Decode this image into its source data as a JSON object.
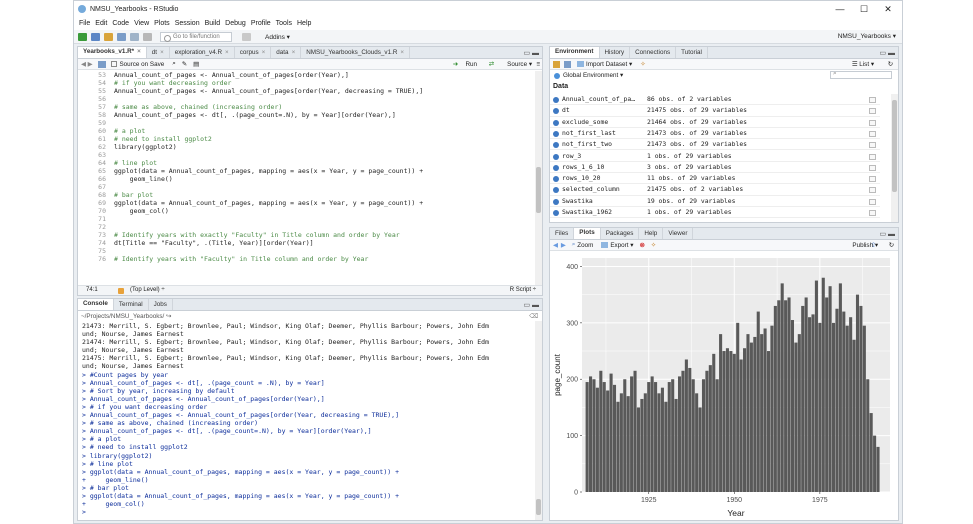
{
  "window": {
    "title": "NMSU_Yearbooks - RStudio",
    "minimize": "—",
    "maximize": "☐",
    "close": "✕"
  },
  "menu": [
    "File",
    "Edit",
    "Code",
    "View",
    "Plots",
    "Session",
    "Build",
    "Debug",
    "Profile",
    "Tools",
    "Help"
  ],
  "toolbar": {
    "goto_placeholder": "Go to file/function",
    "addins": "Addins ▾",
    "project": "NMSU_Yearbooks ▾"
  },
  "editor": {
    "tabs": [
      {
        "label": "Yearbooks_v1.R*",
        "active": true
      },
      {
        "label": "dt",
        "active": false
      },
      {
        "label": "exploration_v4.R",
        "active": false
      },
      {
        "label": "corpus",
        "active": false
      },
      {
        "label": "data",
        "active": false
      },
      {
        "label": "NMSU_Yearbooks_Clouds_v1.R",
        "active": false
      }
    ],
    "source_on_save": "Source on Save",
    "run": "Run",
    "source": "Source ▾",
    "lines": [
      {
        "n": "53",
        "t": "Annual_count_of_pages <- Annual_count_of_pages[order(Year),]"
      },
      {
        "n": "54",
        "t": "# if you want decreasing order"
      },
      {
        "n": "55",
        "t": "Annual_count_of_pages <- Annual_count_of_pages[order(Year, decreasing = TRUE),]"
      },
      {
        "n": "56",
        "t": ""
      },
      {
        "n": "57",
        "t": "# same as above, chained (increasing order)"
      },
      {
        "n": "58",
        "t": "Annual_count_of_pages <- dt[, .(page_count=.N), by = Year][order(Year),]"
      },
      {
        "n": "59",
        "t": ""
      },
      {
        "n": "60",
        "t": "# a plot"
      },
      {
        "n": "61",
        "t": "# need to install ggplot2"
      },
      {
        "n": "62",
        "t": "library(ggplot2)"
      },
      {
        "n": "63",
        "t": ""
      },
      {
        "n": "64",
        "t": "# line plot"
      },
      {
        "n": "65",
        "t": "ggplot(data = Annual_count_of_pages, mapping = aes(x = Year, y = page_count)) +"
      },
      {
        "n": "66",
        "t": "    geom_line()"
      },
      {
        "n": "67",
        "t": ""
      },
      {
        "n": "68",
        "t": "# bar plot"
      },
      {
        "n": "69",
        "t": "ggplot(data = Annual_count_of_pages, mapping = aes(x = Year, y = page_count)) +"
      },
      {
        "n": "70",
        "t": "    geom_col()"
      },
      {
        "n": "71",
        "t": ""
      },
      {
        "n": "72",
        "t": ""
      },
      {
        "n": "73",
        "t": "# Identify years with exactly \"Faculty\" in Title column and order by Year"
      },
      {
        "n": "74",
        "t": "dt[Title == \"Faculty\", .(Title, Year)][order(Year)]"
      },
      {
        "n": "75",
        "t": ""
      },
      {
        "n": "76",
        "t": "# Identify years with \"Faculty\" in Title column and order by Year"
      }
    ],
    "status_pos": "74:1",
    "status_scope": "(Top Level) ÷",
    "status_type": "R Script ÷"
  },
  "console": {
    "tabs": [
      {
        "label": "Console",
        "active": true
      },
      {
        "label": "Terminal",
        "active": false
      },
      {
        "label": "Jobs",
        "active": false
      }
    ],
    "path": "~/Projects/NMSU_Yearbooks/ ↪",
    "lines": [
      {
        "k": "o",
        "t": "21473: Merrill, S. Egbert; Brownlee, Paul; Windsor, King Olaf; Deemer, Phyllis Barbour; Powers, John Edm"
      },
      {
        "k": "o",
        "t": "und; Nourse, James Earnest"
      },
      {
        "k": "o",
        "t": "21474: Merrill, S. Egbert; Brownlee, Paul; Windsor, King Olaf; Deemer, Phyllis Barbour; Powers, John Edm"
      },
      {
        "k": "o",
        "t": "und; Nourse, James Earnest"
      },
      {
        "k": "o",
        "t": "21475: Merrill, S. Egbert; Brownlee, Paul; Windsor, King Olaf; Deemer, Phyllis Barbour; Powers, John Edm"
      },
      {
        "k": "o",
        "t": "und; Nourse, James Earnest"
      },
      {
        "k": "i",
        "t": "> #Count pages by year"
      },
      {
        "k": "i",
        "t": "> Annual_count_of_pages <- dt[, .(page_count = .N), by = Year]"
      },
      {
        "k": "i",
        "t": "> # Sort by year, increasing by default"
      },
      {
        "k": "i",
        "t": "> Annual_count_of_pages <- Annual_count_of_pages[order(Year),]"
      },
      {
        "k": "i",
        "t": "> # if you want decreasing order"
      },
      {
        "k": "i",
        "t": "> Annual_count_of_pages <- Annual_count_of_pages[order(Year, decreasing = TRUE),]"
      },
      {
        "k": "i",
        "t": "> # same as above, chained (increasing order)"
      },
      {
        "k": "i",
        "t": "> Annual_count_of_pages <- dt[, .(page_count=.N), by = Year][order(Year),]"
      },
      {
        "k": "i",
        "t": "> # a plot"
      },
      {
        "k": "i",
        "t": "> # need to install ggplot2"
      },
      {
        "k": "i",
        "t": "> library(ggplot2)"
      },
      {
        "k": "i",
        "t": "> # line plot"
      },
      {
        "k": "i",
        "t": "> ggplot(data = Annual_count_of_pages, mapping = aes(x = Year, y = page_count)) +"
      },
      {
        "k": "i",
        "t": "+     geom_line()"
      },
      {
        "k": "i",
        "t": "> # bar plot"
      },
      {
        "k": "i",
        "t": "> ggplot(data = Annual_count_of_pages, mapping = aes(x = Year, y = page_count)) +"
      },
      {
        "k": "i",
        "t": "+     geom_col()"
      },
      {
        "k": "i",
        "t": ">"
      }
    ]
  },
  "environment": {
    "tabs": [
      {
        "label": "Environment",
        "active": true
      },
      {
        "label": "History",
        "active": false
      },
      {
        "label": "Connections",
        "active": false
      },
      {
        "label": "Tutorial",
        "active": false
      }
    ],
    "import_dataset": "Import Dataset ▾",
    "list_view": "☰ List ▾",
    "scope": "Global Environment ▾",
    "section": "Data",
    "rows": [
      {
        "name": "Annual_count_of_pa…",
        "value": "86 obs. of 2 variables"
      },
      {
        "name": "dt",
        "value": "21475 obs. of 29 variables"
      },
      {
        "name": "exclude_some",
        "value": "21464 obs. of 29 variables"
      },
      {
        "name": "not_first_last",
        "value": "21473 obs. of 29 variables"
      },
      {
        "name": "not_first_two",
        "value": "21473 obs. of 29 variables"
      },
      {
        "name": "row_3",
        "value": "1 obs. of 29 variables"
      },
      {
        "name": "rows_1_6_10",
        "value": "3 obs. of 29 variables"
      },
      {
        "name": "rows_10_20",
        "value": "11 obs. of 29 variables"
      },
      {
        "name": "selected_column",
        "value": "21475 obs. of 2 variables"
      },
      {
        "name": "Swastika",
        "value": "19 obs. of 29 variables"
      },
      {
        "name": "Swastika_1962",
        "value": "1 obs. of 29 variables"
      }
    ]
  },
  "files": {
    "tabs": [
      {
        "label": "Files",
        "active": false
      },
      {
        "label": "Plots",
        "active": true
      },
      {
        "label": "Packages",
        "active": false
      },
      {
        "label": "Help",
        "active": false
      },
      {
        "label": "Viewer",
        "active": false
      }
    ],
    "zoom": "Zoom",
    "export": "Export ▾",
    "publish": "Publish ▾"
  },
  "colors": {
    "bar": "#595959",
    "plot_bg": "#ebebeb",
    "grid": "#ffffff",
    "accent": "#3d78c2"
  },
  "chart_data": {
    "type": "bar",
    "xlabel": "Year",
    "ylabel": "page_count",
    "xlim": [
      1905.5,
      1995.5
    ],
    "ylim": [
      0,
      415
    ],
    "x_ticks": [
      1925,
      1950,
      1975
    ],
    "y_ticks": [
      0,
      100,
      200,
      300,
      400
    ],
    "grid": true,
    "x": [
      1907,
      1908,
      1909,
      1910,
      1911,
      1912,
      1913,
      1914,
      1915,
      1916,
      1917,
      1918,
      1919,
      1920,
      1921,
      1922,
      1923,
      1924,
      1925,
      1926,
      1927,
      1928,
      1929,
      1930,
      1931,
      1932,
      1933,
      1934,
      1935,
      1936,
      1937,
      1938,
      1939,
      1940,
      1941,
      1942,
      1943,
      1944,
      1945,
      1946,
      1947,
      1948,
      1949,
      1950,
      1951,
      1952,
      1953,
      1954,
      1955,
      1956,
      1957,
      1958,
      1959,
      1960,
      1961,
      1962,
      1963,
      1964,
      1965,
      1966,
      1967,
      1968,
      1969,
      1970,
      1971,
      1972,
      1973,
      1974,
      1975,
      1976,
      1977,
      1978,
      1979,
      1980,
      1981,
      1982,
      1983,
      1984,
      1985,
      1986,
      1987,
      1988,
      1989,
      1990,
      1991,
      1992
    ],
    "values": [
      195,
      205,
      200,
      185,
      215,
      195,
      180,
      210,
      190,
      160,
      175,
      200,
      170,
      205,
      215,
      150,
      165,
      175,
      195,
      205,
      195,
      175,
      185,
      160,
      195,
      200,
      165,
      205,
      215,
      235,
      220,
      200,
      175,
      150,
      200,
      215,
      225,
      245,
      200,
      280,
      250,
      255,
      250,
      245,
      300,
      235,
      255,
      280,
      265,
      275,
      320,
      280,
      290,
      250,
      295,
      330,
      340,
      370,
      340,
      345,
      305,
      265,
      280,
      330,
      345,
      310,
      315,
      375,
      300,
      380,
      345,
      365,
      300,
      325,
      370,
      320,
      295,
      310,
      270,
      350,
      330,
      295,
      200,
      140,
      100,
      80
    ]
  }
}
